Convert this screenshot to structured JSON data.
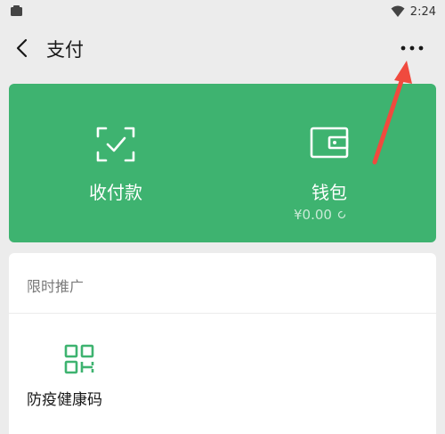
{
  "status_bar": {
    "time": "2:24",
    "icons": [
      "app-icon",
      "wifi-icon"
    ]
  },
  "nav": {
    "title": "支付",
    "back_icon": "back-arrow-icon",
    "more_icon": "more-dots-icon"
  },
  "pay_card": {
    "background": "#3eb370",
    "receive_pay": {
      "label": "收付款",
      "icon": "scan-check-icon"
    },
    "wallet": {
      "label": "钱包",
      "balance": "¥0.00",
      "icon": "wallet-icon"
    }
  },
  "promo": {
    "header": "限时推广",
    "items": [
      {
        "label": "防疫健康码",
        "icon": "qr-code-icon"
      }
    ]
  },
  "annotation": {
    "color": "#f04a3e"
  }
}
